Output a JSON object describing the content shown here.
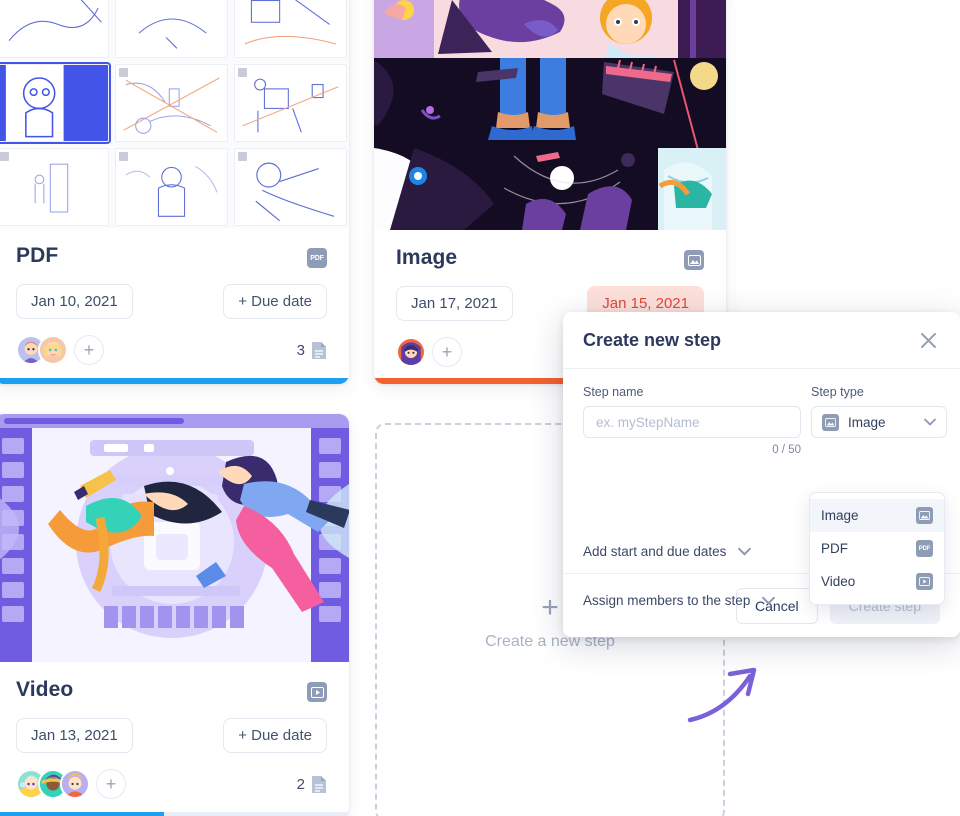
{
  "board": {
    "cards": [
      {
        "id": "pdf",
        "title": "PDF",
        "type_icon": "pdf-badge-icon",
        "start_date": "Jan 10, 2021",
        "due_date": "+ Due date",
        "due_overdue": false,
        "attachment_count": "3",
        "member_count": 2,
        "progress_percent": 100,
        "progress_color": "#1ba0f2"
      },
      {
        "id": "image",
        "title": "Image",
        "type_icon": "image-badge-icon",
        "start_date": "Jan 17, 2021",
        "due_date": "Jan 15, 2021",
        "due_overdue": true,
        "attachment_count": "",
        "member_count": 1,
        "progress_percent": 100,
        "progress_color": "#f4602e"
      },
      {
        "id": "video",
        "title": "Video",
        "type_icon": "video-badge-icon",
        "start_date": "Jan 13, 2021",
        "due_date": "+ Due date",
        "due_overdue": false,
        "attachment_count": "2",
        "member_count": 3,
        "progress_percent": 48,
        "progress_color": "#1ba0f2"
      }
    ],
    "placeholder": {
      "plus_icon": "plus-icon",
      "label": "Create a new step"
    }
  },
  "modal": {
    "title": "Create new step",
    "close_icon": "close-icon",
    "step_name": {
      "label": "Step name",
      "value": "",
      "placeholder": "ex. myStepName",
      "counter": "0 / 50"
    },
    "step_type": {
      "label": "Step type",
      "selected": "Image",
      "selected_icon": "image-badge-icon",
      "chevron_icon": "chevron-down-icon",
      "options": [
        {
          "label": "Image",
          "icon": "image-badge-icon",
          "selected": true
        },
        {
          "label": "PDF",
          "icon": "pdf-badge-icon",
          "selected": false
        },
        {
          "label": "Video",
          "icon": "video-badge-icon",
          "selected": false
        }
      ]
    },
    "accordions": [
      {
        "label": "Add start and due dates",
        "icon": "chevron-down-icon"
      },
      {
        "label": "Assign members to the step",
        "icon": "chevron-down-icon"
      }
    ],
    "footer": {
      "cancel_label": "Cancel",
      "create_label": "Create step",
      "create_disabled": true
    }
  },
  "colors": {
    "blue_progress": "#1ba0f2",
    "orange_progress": "#f4602e",
    "overdue_text": "#e0483b",
    "overdue_bg": "#fde0da",
    "title_text": "#2b3a5c",
    "arrow_purple": "#7b61d9",
    "badge_gray": "#8f9cb5"
  }
}
